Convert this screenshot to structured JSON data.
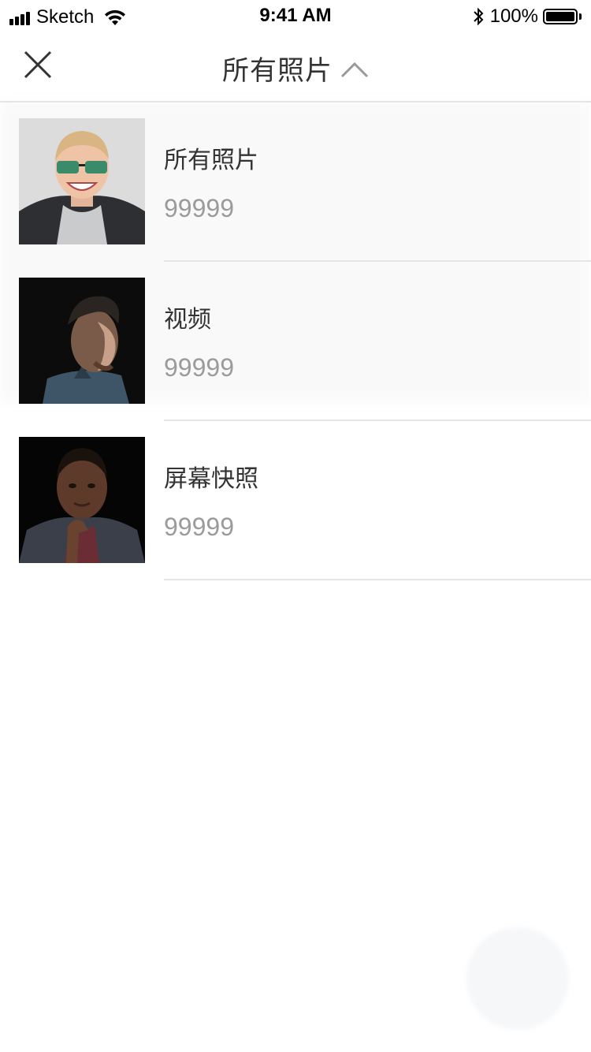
{
  "status_bar": {
    "carrier": "Sketch",
    "time": "9:41 AM",
    "battery": "100%",
    "battery_level": 1.0
  },
  "nav": {
    "title": "所有照片",
    "close_icon": "close-icon",
    "toggle_icon": "chevron-up-icon"
  },
  "albums": [
    {
      "name": "所有照片",
      "count": "99999",
      "thumb": "man-with-sunglasses"
    },
    {
      "name": "视频",
      "count": "99999",
      "thumb": "man-profile-dark"
    },
    {
      "name": "屏幕快照",
      "count": "99999",
      "thumb": "man-hand-on-chin"
    }
  ]
}
